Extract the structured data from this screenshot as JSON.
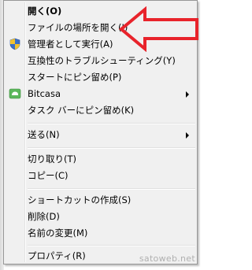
{
  "menu": {
    "items": [
      {
        "label": "開く(O)"
      },
      {
        "label": "ファイルの場所を開く(I)"
      },
      {
        "label": "管理者として実行(A)",
        "icon": "uac-shield-icon"
      },
      {
        "label": "互換性のトラブルシューティング(Y)"
      },
      {
        "label": "スタートにピン留め(P)"
      },
      {
        "label": "Bitcasa",
        "icon": "bitcasa-icon",
        "submenu": true
      },
      {
        "label": "タスク バーにピン留め(K)"
      },
      {
        "label": "送る(N)",
        "submenu": true
      },
      {
        "label": "切り取り(T)"
      },
      {
        "label": "コピー(C)"
      },
      {
        "label": "ショートカットの作成(S)"
      },
      {
        "label": "削除(D)"
      },
      {
        "label": "名前の変更(M)"
      },
      {
        "label": "プロパティ(R)"
      }
    ]
  },
  "annotation": {
    "icon": "red-arrow-icon",
    "color": "#e8232b"
  },
  "watermark": "satoweb.net"
}
